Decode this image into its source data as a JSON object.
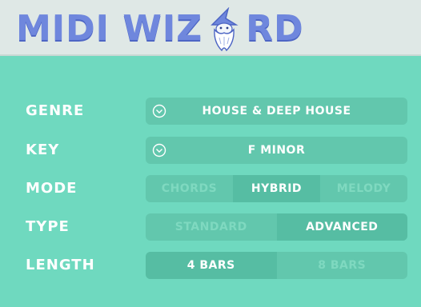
{
  "app": {
    "title": "MIDI WIZARD",
    "title_part1": "MIDI WIZ",
    "title_part2": "RD"
  },
  "settings": {
    "genre": {
      "label": "GENRE",
      "value": "HOUSE & DEEP HOUSE"
    },
    "key": {
      "label": "KEY",
      "value": "F MINOR"
    },
    "mode": {
      "label": "MODE",
      "options": [
        "CHORDS",
        "HYBRID",
        "MELODY"
      ],
      "selected": "HYBRID"
    },
    "type": {
      "label": "TYPE",
      "options": [
        "STANDARD",
        "ADVANCED"
      ],
      "selected": "ADVANCED"
    },
    "length": {
      "label": "LENGTH",
      "options": [
        "4 BARS",
        "8 BARS"
      ],
      "selected": "4 BARS"
    }
  },
  "icons": {
    "dropdown": "chevron-down-circle-icon",
    "logo_character": "wizard-icon"
  },
  "colors": {
    "background": "#6fd9bf",
    "header": "#dfe8e6",
    "logo": "#6f87dd",
    "control": "#62c7ad",
    "active_segment": "#56bda3"
  }
}
